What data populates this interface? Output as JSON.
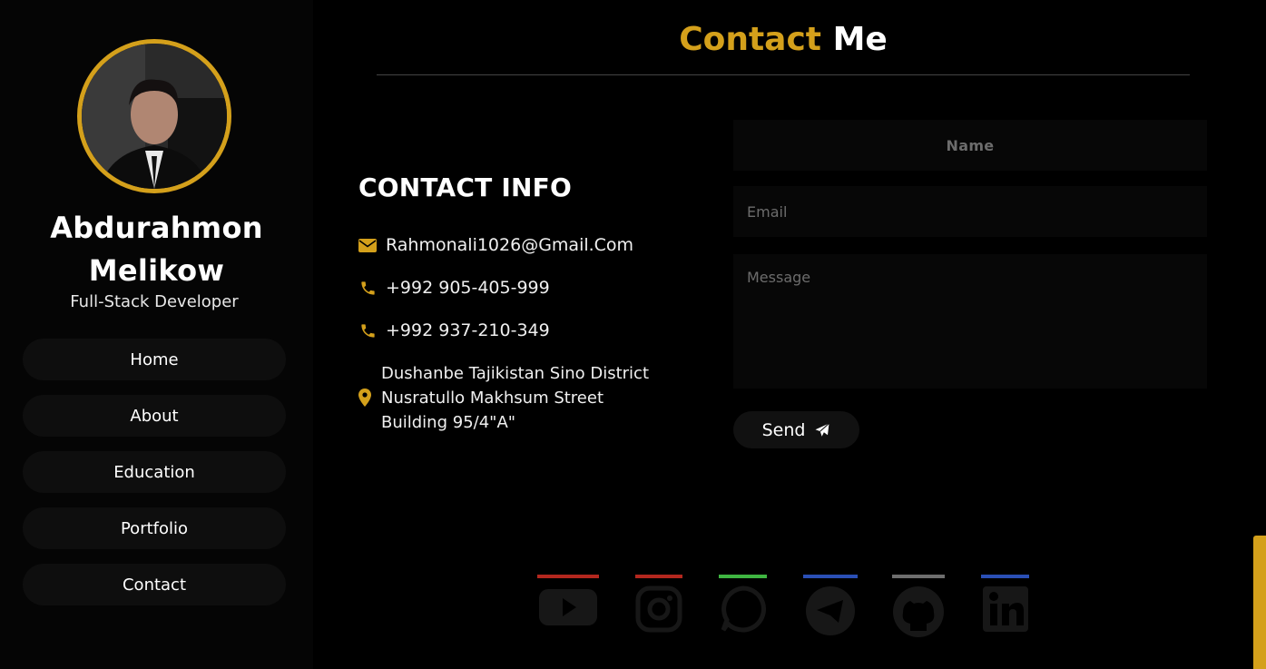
{
  "sidebar": {
    "name": "Abdurahmon Melikow",
    "role": "Full-Stack Developer",
    "nav": [
      {
        "label": "Home"
      },
      {
        "label": "About"
      },
      {
        "label": "Education"
      },
      {
        "label": "Portfolio"
      },
      {
        "label": "Contact"
      }
    ]
  },
  "page": {
    "title_accent": "Contact",
    "title_rest": " Me"
  },
  "contact_info": {
    "heading": "CONTACT INFO",
    "email": "Rahmonali1026@Gmail.Com",
    "phone1": "+992 905-405-999",
    "phone2": "+992 937-210-349",
    "address": "Dushanbe Tajikistan Sino District Nusratullo Makhsum Street Building 95/4\"A\""
  },
  "form": {
    "name_placeholder": "Name",
    "email_placeholder": "Email",
    "message_placeholder": "Message",
    "send_label": "Send"
  },
  "social": [
    {
      "icon": "youtube-icon",
      "color": "#b3271e"
    },
    {
      "icon": "instagram-icon",
      "color": "#b3271e"
    },
    {
      "icon": "whatsapp-icon",
      "color": "#3fb541"
    },
    {
      "icon": "telegram-icon",
      "color": "#2a4fb5"
    },
    {
      "icon": "github-icon",
      "color": "#6e6e6e"
    },
    {
      "icon": "linkedin-icon",
      "color": "#2a4fb5"
    }
  ],
  "colors": {
    "accent": "#d4a01b",
    "background": "#000000"
  }
}
